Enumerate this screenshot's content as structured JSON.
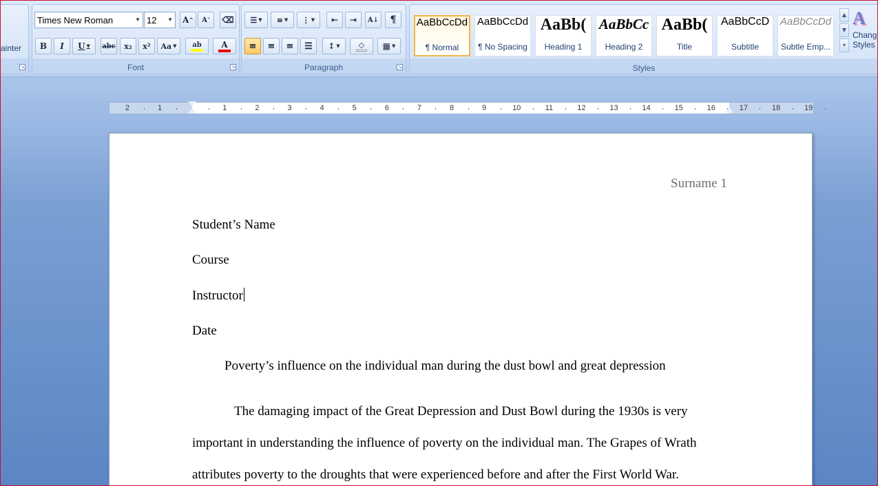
{
  "ribbon": {
    "clipboard": {
      "format_painter_label": "ainter"
    },
    "font": {
      "label": "Font",
      "font_name": "Times New Roman",
      "font_size": "12",
      "grow_font": "A",
      "shrink_font": "A",
      "bold": "B",
      "italic": "I",
      "underline": "U",
      "strike": "abc",
      "subscript": "x₂",
      "superscript": "x²",
      "change_case": "Aa",
      "highlight_color": "#ffff00",
      "font_color": "#e00000"
    },
    "paragraph": {
      "label": "Paragraph",
      "show_marks": "¶"
    },
    "styles": {
      "label": "Styles",
      "items": [
        {
          "preview": "AaBbCcDd",
          "name": "¶ Normal"
        },
        {
          "preview": "AaBbCcDd",
          "name": "¶ No Spacing"
        },
        {
          "preview": "AaBb(",
          "name": "Heading 1"
        },
        {
          "preview": "AaBbCc",
          "name": "Heading 2"
        },
        {
          "preview": "AaBb(",
          "name": "Title"
        },
        {
          "preview": "AaBbCcD",
          "name": "Subtitle"
        },
        {
          "preview": "AaBbCcDd",
          "name": "Subtle Emp..."
        }
      ],
      "change_styles_line1": "Chang",
      "change_styles_line2": "Styles"
    }
  },
  "ruler": {
    "labels": [
      "2",
      "1",
      "",
      "1",
      "2",
      "3",
      "4",
      "5",
      "6",
      "7",
      "8",
      "9",
      "10",
      "11",
      "12",
      "13",
      "14",
      "15",
      "16",
      "17",
      "18",
      "19"
    ]
  },
  "document": {
    "header_text": "Surname 1",
    "student_name": "Student’s Name",
    "course": "Course",
    "instructor": "Instructor",
    "date": "Date",
    "title": "Poverty’s influence on the individual man during the dust bowl and great depression",
    "body_lines": [
      "The damaging impact of the Great Depression and Dust Bowl during the 1930s is very",
      "important in understanding the influence of poverty on the individual man. The Grapes of Wrath",
      "attributes poverty to the droughts that were experienced before and after the First World War."
    ]
  }
}
